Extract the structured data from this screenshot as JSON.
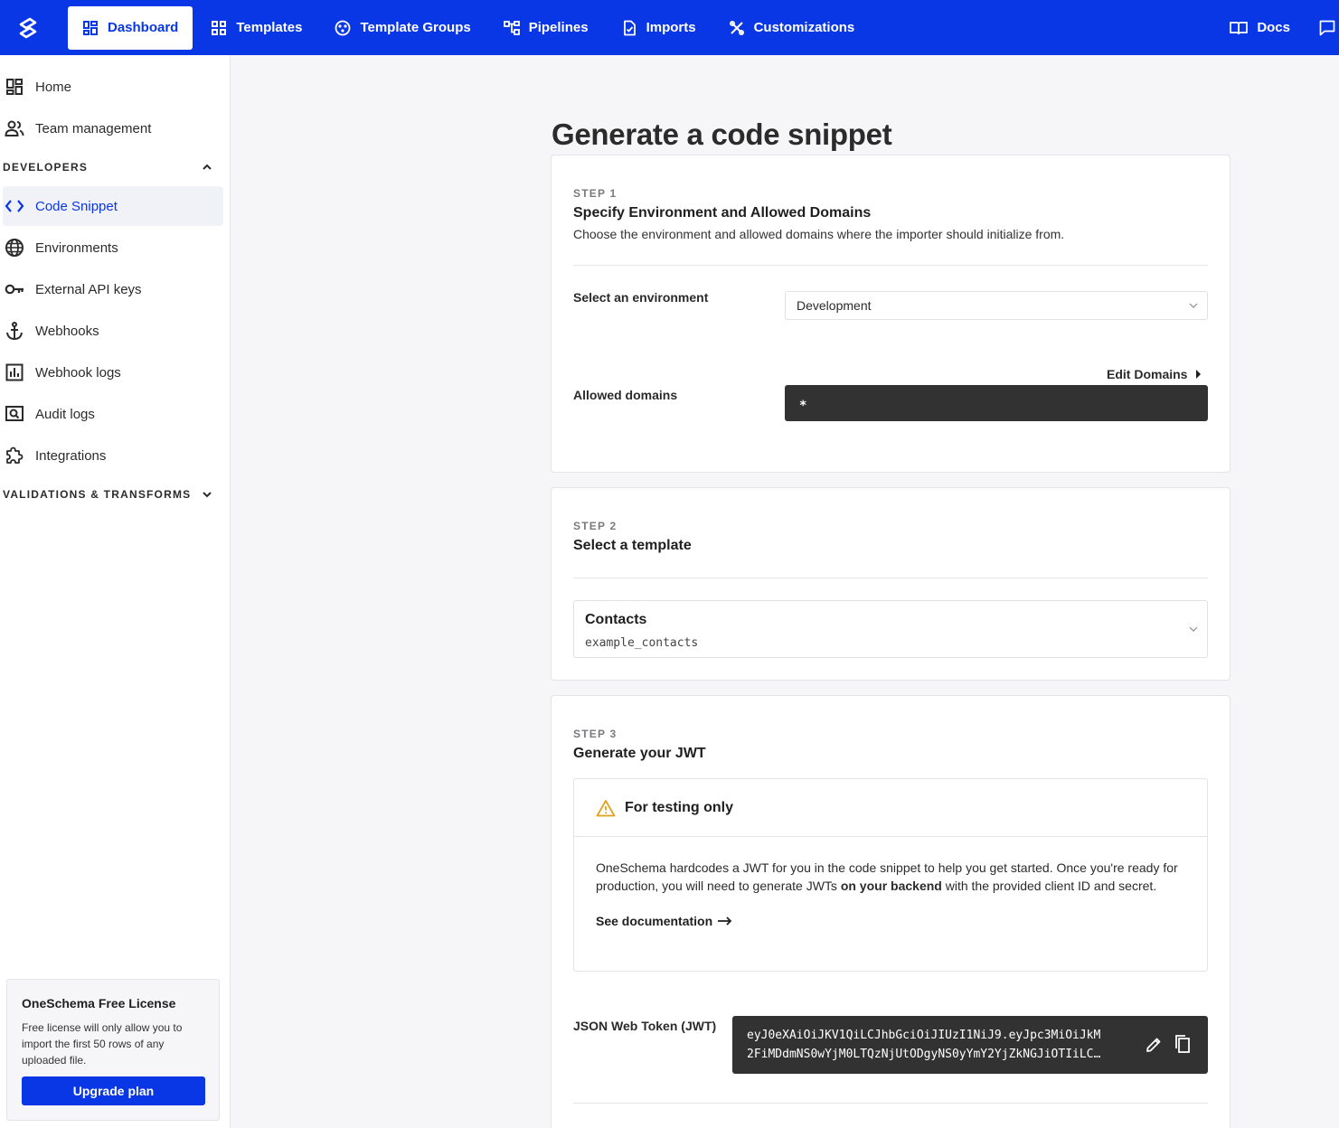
{
  "topnav": {
    "items": [
      {
        "label": "Dashboard",
        "icon": "dashboard-icon",
        "active": true
      },
      {
        "label": "Templates",
        "icon": "grid-icon"
      },
      {
        "label": "Template Groups",
        "icon": "template-groups-icon"
      },
      {
        "label": "Pipelines",
        "icon": "pipelines-icon"
      },
      {
        "label": "Imports",
        "icon": "imports-icon"
      },
      {
        "label": "Customizations",
        "icon": "customizations-icon"
      }
    ],
    "docs_label": "Docs",
    "accent": "#0a37e6"
  },
  "sidebar": {
    "home": "Home",
    "team": "Team management",
    "developers_section": "DEVELOPERS",
    "code_snippet": "Code Snippet",
    "environments": "Environments",
    "api_keys": "External API keys",
    "webhooks": "Webhooks",
    "webhook_logs": "Webhook logs",
    "audit_logs": "Audit logs",
    "integrations": "Integrations",
    "validations_section": "VALIDATIONS & TRANSFORMS",
    "license": {
      "title": "OneSchema Free License",
      "text": "Free license will only allow you to import the first 50 rows of any uploaded file.",
      "button": "Upgrade plan"
    }
  },
  "main": {
    "title": "Generate a code snippet",
    "step1": {
      "label": "STEP 1",
      "title": "Specify Environment and Allowed Domains",
      "desc": "Choose the environment and allowed domains where the importer should initialize from.",
      "env_label": "Select an environment",
      "env_value": "Development",
      "edit_domains": "Edit Domains",
      "domains_label": "Allowed domains",
      "domains_value": "*"
    },
    "step2": {
      "label": "STEP 2",
      "title": "Select a template",
      "template_name": "Contacts",
      "template_key": "example_contacts"
    },
    "step3": {
      "label": "STEP 3",
      "title": "Generate your JWT",
      "warning_title": "For testing only",
      "warning_text_1": "OneSchema hardcodes a JWT for you in the code snippet to help you get started. Once you're ready for production, you will need to generate JWTs ",
      "warning_bold": "on your backend",
      "warning_text_2": " with the provided client ID and secret.",
      "doc_link": "See documentation",
      "jwt_label": "JSON Web Token (JWT)",
      "jwt_line1": "eyJ0eXAiOiJKV1QiLCJhbGciOiJIUzI1NiJ9.eyJpc3MiOiJkM",
      "jwt_line2": "2FiMDdmNS0wYjM0LTQzNjUtODgyNS0yYmY2YjZkNGJiOTIiLC…"
    }
  }
}
